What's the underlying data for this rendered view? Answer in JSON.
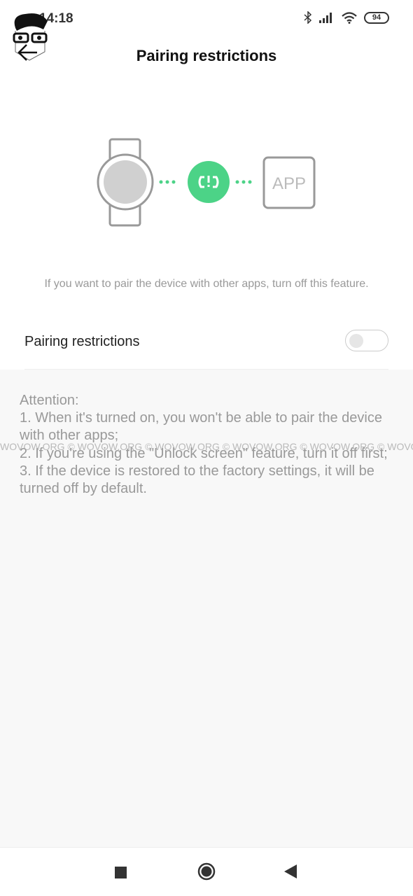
{
  "status_bar": {
    "time": "14:18",
    "battery": "94",
    "icons": [
      "bluetooth-icon",
      "signal-icon",
      "wifi-icon",
      "battery-icon"
    ]
  },
  "header": {
    "title": "Pairing restrictions",
    "back_icon": "arrow-left-icon"
  },
  "illustration": {
    "app_label": "APP",
    "accent": "#4cd387"
  },
  "description": "If you want to pair the device with other apps, turn off this feature.",
  "setting": {
    "label": "Pairing restrictions",
    "enabled": false
  },
  "attention": {
    "heading": "Attention:",
    "items": [
      "1. When it's turned on, you won't be able to pair the device with other apps;",
      "2. If you're using the \"Unlock screen\" feature, turn it off first;",
      "3. If the device is restored to the factory settings, it will be turned off by default."
    ]
  },
  "watermark": "WOVOW.ORG © WOVOW.ORG © WOVOW.ORG © WOVOW.ORG © WOVOW.ORG © WOVOW.ORG ©",
  "nav": {
    "icons": [
      "recents-square-icon",
      "home-circle-icon",
      "back-triangle-icon"
    ]
  }
}
